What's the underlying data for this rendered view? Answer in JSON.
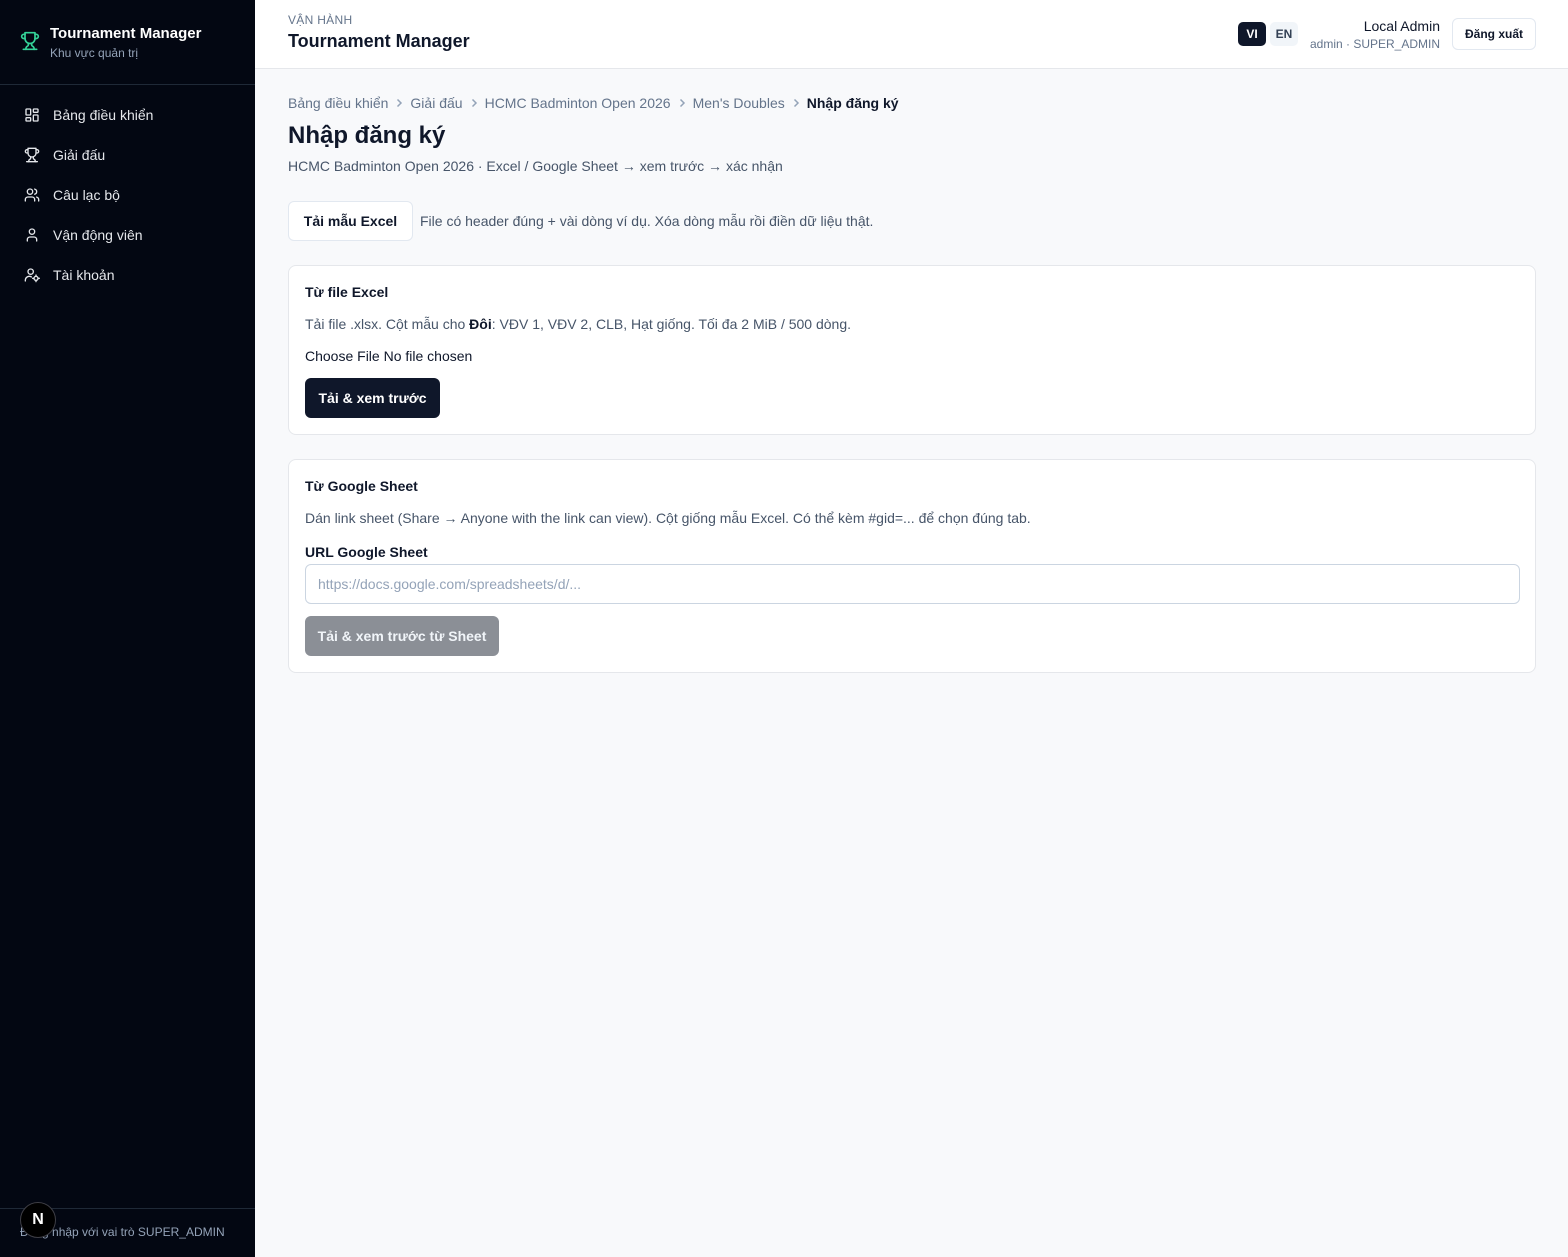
{
  "sidebar": {
    "brand_title": "Tournament Manager",
    "brand_subtitle": "Khu vực quản trị",
    "items": [
      {
        "label": "Bảng điều khiển",
        "icon": "dashboard-icon"
      },
      {
        "label": "Giải đấu",
        "icon": "trophy-icon"
      },
      {
        "label": "Câu lạc bộ",
        "icon": "users-icon"
      },
      {
        "label": "Vận động viên",
        "icon": "user-icon"
      },
      {
        "label": "Tài khoản",
        "icon": "user-cog-icon"
      }
    ],
    "footer": "Đăng nhập với vai trò SUPER_ADMIN",
    "badge": "N"
  },
  "header": {
    "kicker": "VẬN HÀNH",
    "title": "Tournament Manager",
    "lang_vi": "VI",
    "lang_en": "EN",
    "user_name": "Local Admin",
    "user_role": "admin · SUPER_ADMIN",
    "logout": "Đăng xuất"
  },
  "breadcrumb": [
    "Bảng điều khiển",
    "Giải đấu",
    "HCMC Badminton Open 2026",
    "Men's Doubles",
    "Nhập đăng ký"
  ],
  "page": {
    "title": "Nhập đăng ký",
    "subtitle": "HCMC Badminton Open 2026 · Excel / Google Sheet → xem trước → xác nhận",
    "template_button": "Tải mẫu Excel",
    "template_note": "File có header đúng + vài dòng ví dụ. Xóa dòng mẫu rồi điền dữ liệu thật."
  },
  "excel_card": {
    "title": "Từ file Excel",
    "desc_before": "Tải file .xlsx. Cột mẫu cho ",
    "desc_bold": "Đôi",
    "desc_after": ": VĐV 1, VĐV 2, CLB, Hạt giống. Tối đa 2 MiB / 500 dòng.",
    "file_button": "Choose File",
    "file_status": "No file chosen",
    "submit": "Tải & xem trước"
  },
  "sheet_card": {
    "title": "Từ Google Sheet",
    "desc": "Dán link sheet (Share → Anyone with the link can view). Cột giống mẫu Excel. Có thể kèm #gid=... để chọn đúng tab.",
    "field_label": "URL Google Sheet",
    "placeholder": "https://docs.google.com/spreadsheets/d/...",
    "value": "",
    "submit": "Tải & xem trước từ Sheet"
  },
  "colors": {
    "sidebar_bg": "#030712",
    "accent_trophy": "#34d399",
    "primary": "#0f172a",
    "disabled": "#8b8f96"
  }
}
